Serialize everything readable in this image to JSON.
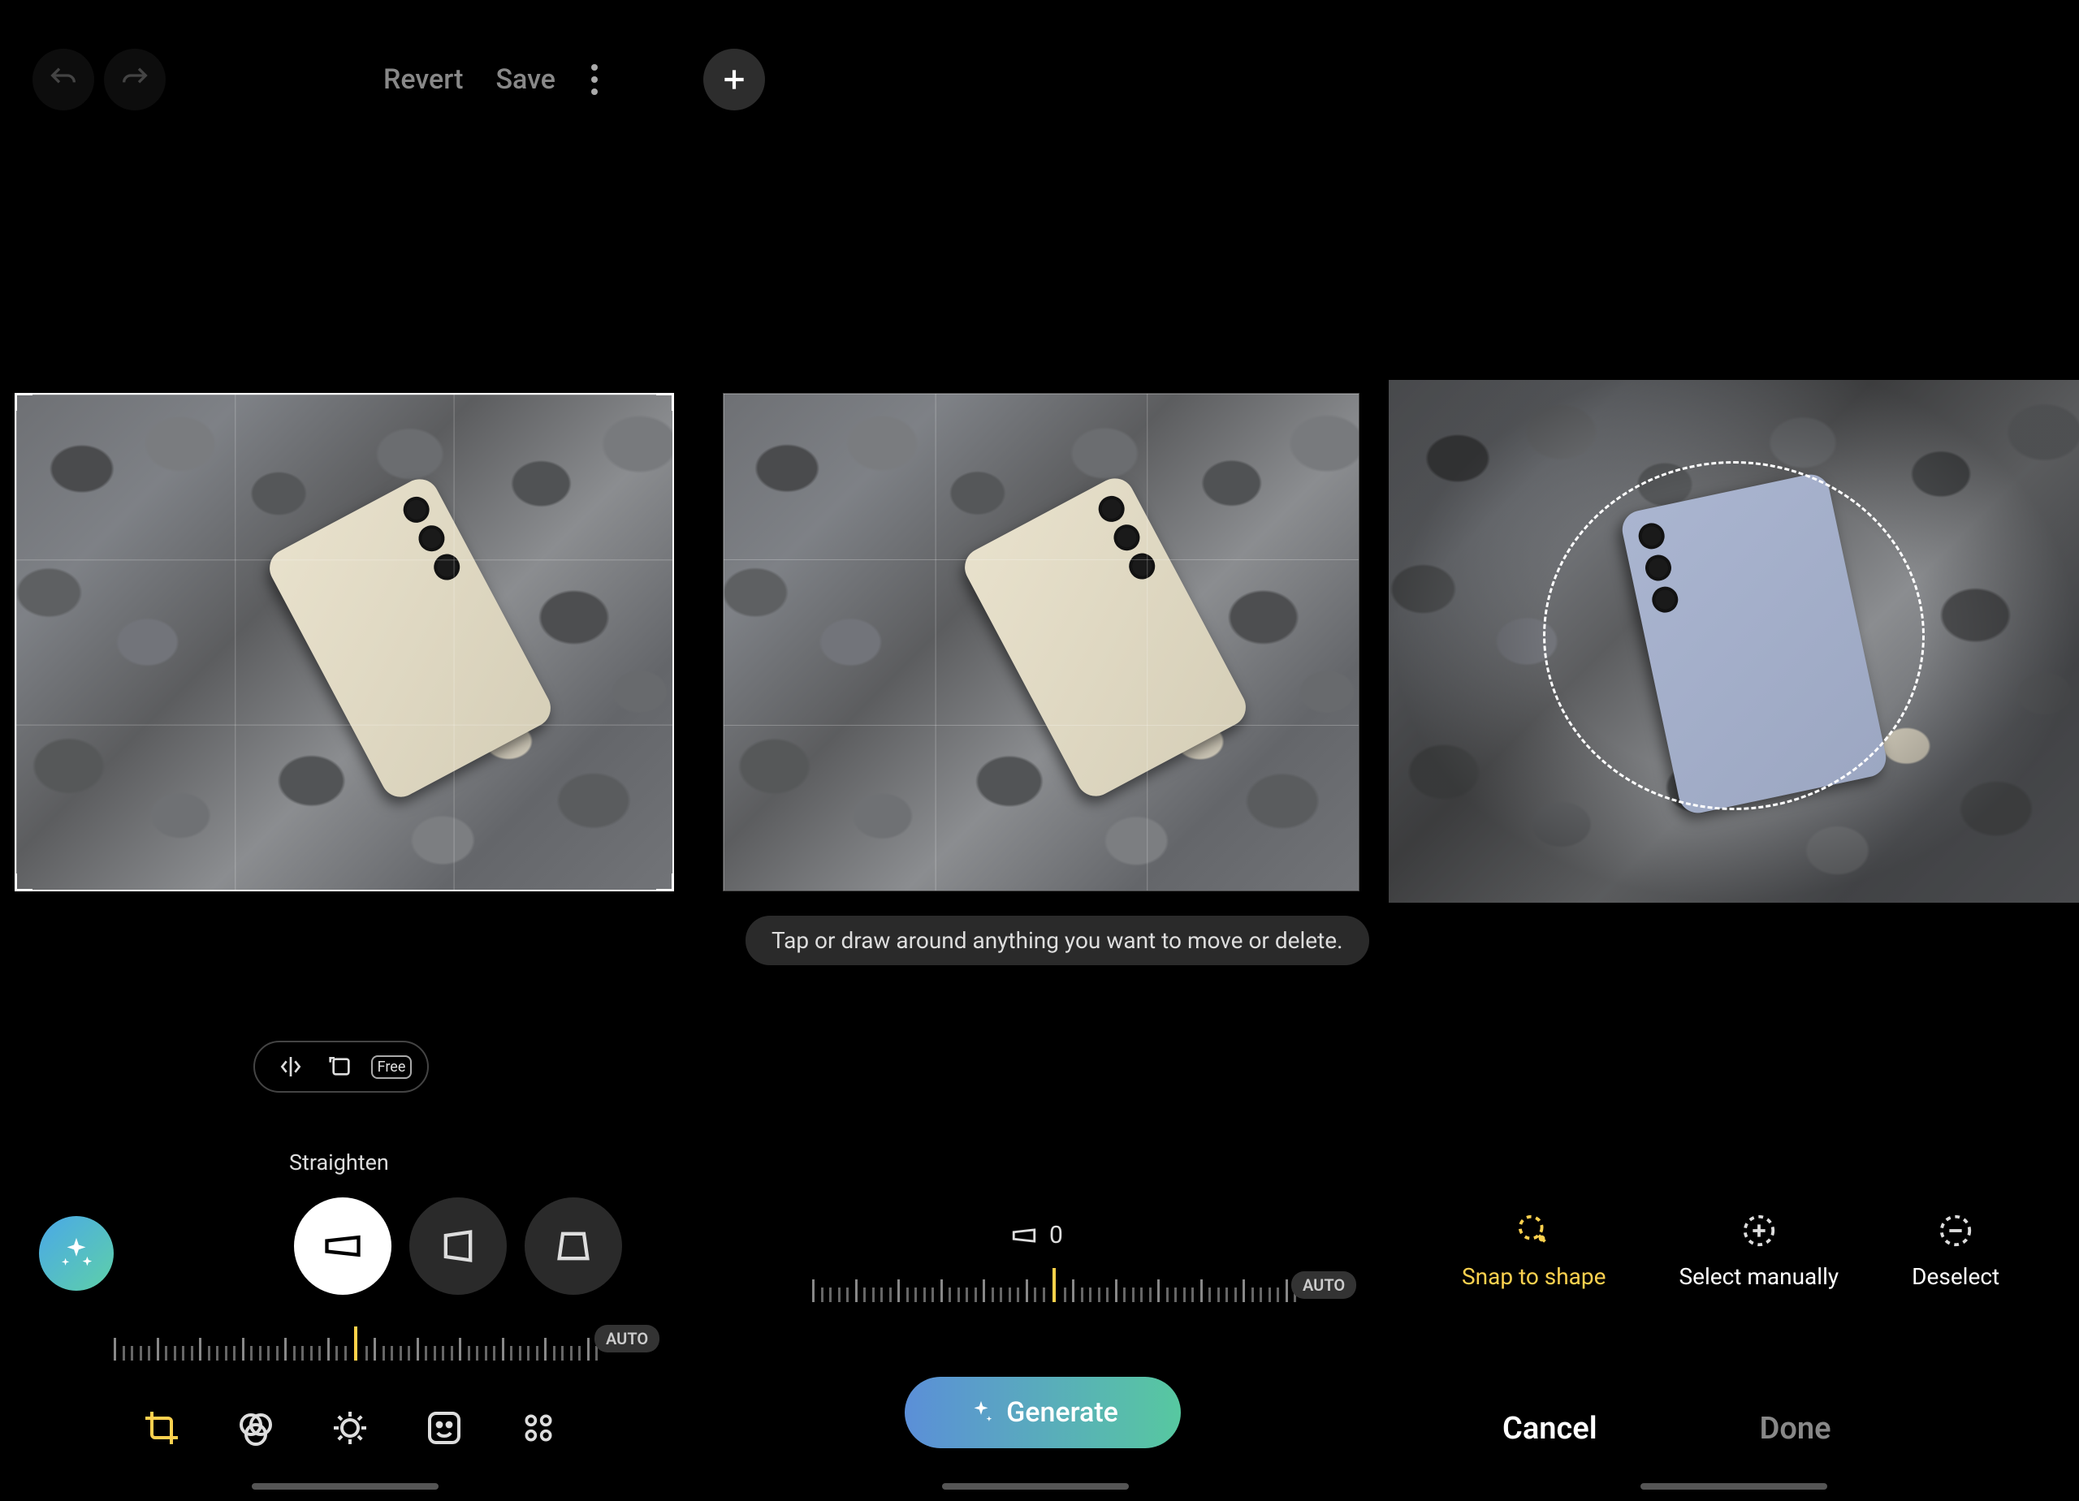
{
  "toolbar": {
    "revert_label": "Revert",
    "save_label": "Save"
  },
  "tooltip": "Tap or draw around anything you want to move or delete.",
  "transform": {
    "mode_label": "Straighten",
    "value": "0",
    "auto_label": "AUTO"
  },
  "crop": {
    "free_label": "Free"
  },
  "generate": {
    "label": "Generate"
  },
  "selection": {
    "snap_label": "Snap to shape",
    "manual_label": "Select manually",
    "deselect_label": "Deselect"
  },
  "actions": {
    "cancel_label": "Cancel",
    "done_label": "Done"
  }
}
